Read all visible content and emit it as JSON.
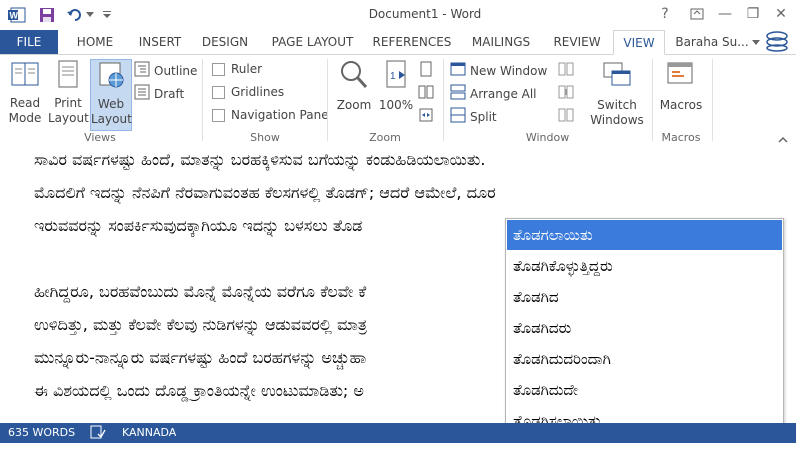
{
  "titlebar": {
    "title": "Document1 - Word",
    "help": "?",
    "minimize": "—",
    "restore": "❐",
    "close": "✕"
  },
  "tabs": [
    "FILE",
    "HOME",
    "INSERT",
    "DESIGN",
    "PAGE LAYOUT",
    "REFERENCES",
    "MAILINGS",
    "REVIEW",
    "VIEW"
  ],
  "account": "Baraha Su...",
  "ribbon": {
    "views": {
      "read_mode": "Read\nMode",
      "print_layout": "Print\nLayout",
      "web_layout": "Web\nLayout",
      "outline": "Outline",
      "draft": "Draft",
      "label": "Views"
    },
    "show": {
      "ruler": "Ruler",
      "gridlines": "Gridlines",
      "navigation_pane": "Navigation Pane",
      "label": "Show"
    },
    "zoom": {
      "zoom": "Zoom",
      "zoom100": "100%",
      "label": "Zoom"
    },
    "window": {
      "new_window": "New Window",
      "arrange_all": "Arrange All",
      "split": "Split",
      "switch_windows": "Switch\nWindows",
      "label": "Window"
    },
    "macros": {
      "macros": "Macros",
      "label": "Macros"
    }
  },
  "document": {
    "lines": [
      "ಸಾವಿರ ವರ್ಷಗಳಷ್ಟು ಹಿಂದೆ, ಮಾತನ್ನು ಬರಹಕ್ಕಿಳಿಸುವ ಬಗೆಯನ್ನು ಕಂಡುಹಿಡಿಯಲಾಯಿತು.",
      "ಮೊದಲಿಗೆ ಇದನ್ನು ನೆನಪಿಗೆ ನೆರವಾಗುವಂತಹ ಕೆಲಸಗಳಲ್ಲಿ ತೊಡಗ್; ಆದರೆ ಆಮೇಲೆ, ದೂರ",
      "ಇರುವವರನ್ನು ಸಂಪರ್ಕಿಸುವುದಕ್ಕಾಗಿಯೂ ಇದನ್ನು ಬಳಸಲು ತೊಡ",
      "",
      "ಹೀಗಿದ್ದರೂ, ಬರಹವೆಂಬುದು ಮೊನ್ನೆ ಮೊನ್ನೆಯ ವರೆಗೂ ಕೆಲವೇ ಕೆ",
      "ಉಳಿದಿತ್ತು, ಮತ್ತು ಕೆಲವೇ ಕೆಲವು ನುಡಿಗಳನ್ನು ಆಡುವವರಲ್ಲಿ ಮಾತ್ರ",
      "ಮುನ್ನೂರು-ನಾನ್ನೂರು ವರ್ಷಗಳಷ್ಟು ಹಿಂದೆ ಬರಹಗಳನ್ನು ಅಚ್ಚುಹಾ",
      "ಈ ವಿಶಯದಲ್ಲಿ ಒಂದು ದೊಡ್ಡ ಕ್ರಾಂತಿಯನ್ನೇ ಉಂಟುಮಾಡಿತು; ಅ"
    ]
  },
  "autocomplete": {
    "items": [
      "ತೊಡಗಲಾಯಿತು",
      "ತೊಡಗಿಕೊಳ್ಳುತ್ತಿದ್ದರು",
      "ತೊಡಗಿದ",
      "ತೊಡಗಿದರು",
      "ತೊಡಗಿದುದರಿಂದಾಗಿ",
      "ತೊಡಗಿದುದೇ",
      "ತೊಡಗಿಸಲಾಯಿತು"
    ],
    "selected_index": 0
  },
  "status": {
    "words": "635 WORDS",
    "language": "KANNADA"
  },
  "colors": {
    "accent": "#2b579a",
    "selection": "#3b7bdb"
  }
}
